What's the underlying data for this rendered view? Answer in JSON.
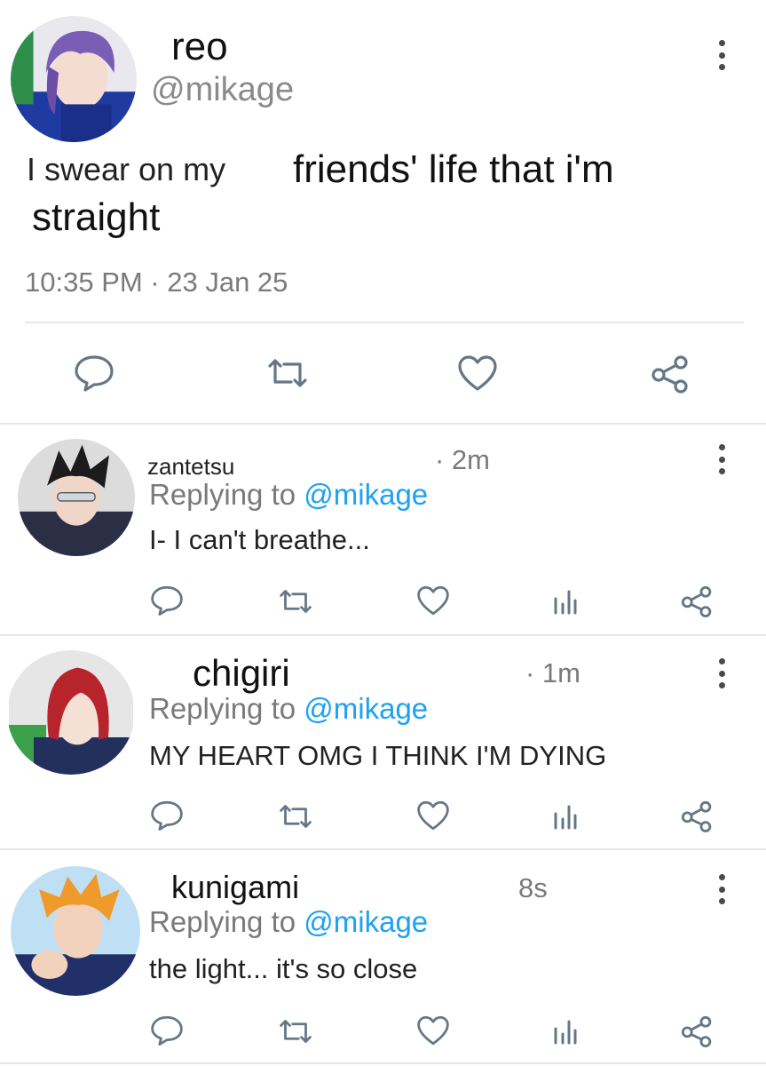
{
  "main_tweet": {
    "display_name": "reo",
    "handle": "@mikage",
    "text_part1": "I swear on my",
    "text_part2": "friends' life that i'm",
    "text_line2": "straight",
    "timestamp": "10:35 PM · 23 Jan 25",
    "avatar_icon": "purple-hair-avatar"
  },
  "replies": [
    {
      "name": "zantetsu",
      "time": "· 2m",
      "replying_prefix": "Replying to",
      "replying_handle": "@mikage",
      "text": "I- I can't breathe..."
    },
    {
      "name": "chigiri",
      "time": "· 1m",
      "replying_prefix": "Replying to",
      "replying_handle": "@mikage",
      "text": "MY HEART OMG I THINK I'M DYING"
    },
    {
      "name": "kunigami",
      "time": "8s",
      "replying_prefix": "Replying to",
      "replying_handle": "@mikage",
      "text": "the light... it's so close"
    }
  ],
  "colors": {
    "link": "#1da1f2",
    "icon": "#657786",
    "meta": "#7a7a7a"
  }
}
